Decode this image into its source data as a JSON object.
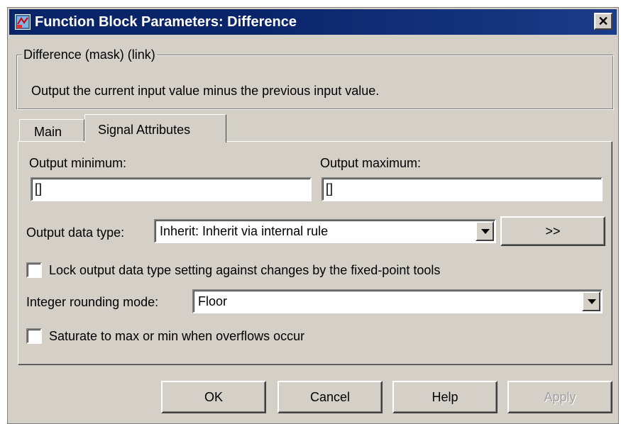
{
  "window": {
    "title": "Function Block Parameters: Difference",
    "close_symbol": "✕"
  },
  "group": {
    "legend": "Difference (mask) (link)",
    "description": "Output the current input value minus the previous input value."
  },
  "tabs": [
    {
      "label": "Main",
      "active": false
    },
    {
      "label": "Signal Attributes",
      "active": true
    }
  ],
  "signal_attributes": {
    "output_min_label": "Output minimum:",
    "output_min_value": "[]",
    "output_max_label": "Output maximum:",
    "output_max_value": "[]",
    "data_type_label": "Output data type:",
    "data_type_value": "Inherit: Inherit via internal rule",
    "data_type_assistant": ">>",
    "lock_label": "Lock output data type setting against changes by the fixed-point tools",
    "lock_checked": false,
    "rounding_label": "Integer rounding mode:",
    "rounding_value": "Floor",
    "saturate_label": "Saturate to max or min when overflows occur",
    "saturate_checked": false
  },
  "buttons": {
    "ok": "OK",
    "cancel": "Cancel",
    "help": "Help",
    "apply": "Apply"
  }
}
